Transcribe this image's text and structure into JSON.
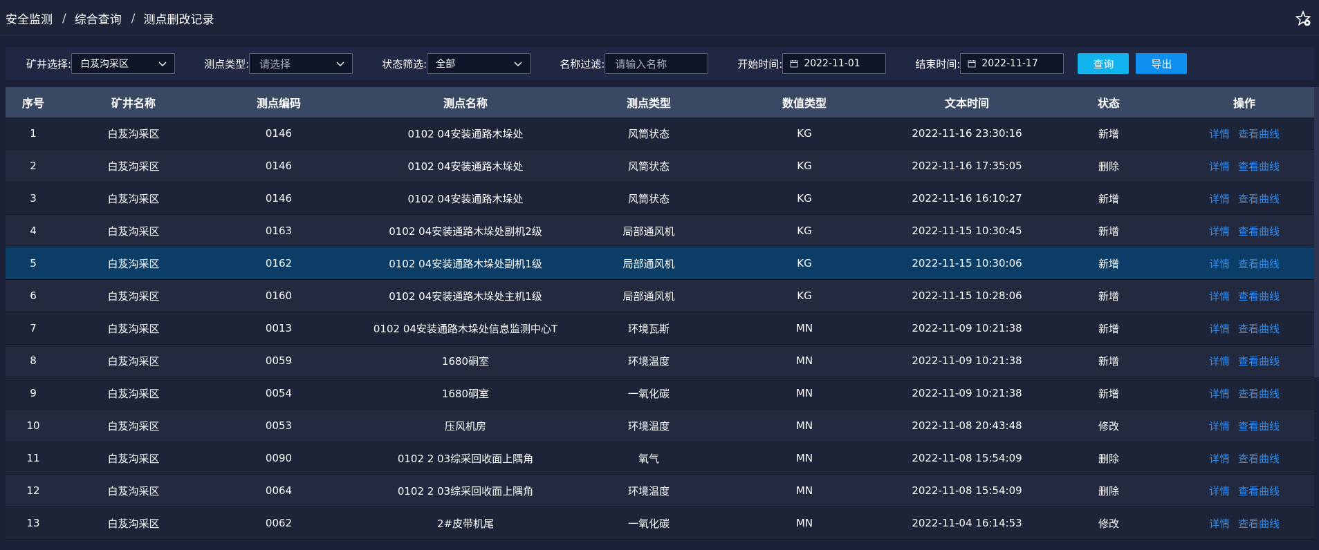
{
  "breadcrumb": [
    "安全监测",
    "综合查询",
    "测点删改记录"
  ],
  "breadcrumb_sep": "/",
  "filters": {
    "mine_label": "矿井选择:",
    "mine_value": "白芨沟采区",
    "type_label": "测点类型:",
    "type_placeholder": "请选择",
    "status_label": "状态筛选:",
    "status_value": "全部",
    "name_label": "名称过滤:",
    "name_placeholder": "请输入名称",
    "start_label": "开始时间:",
    "start_value": "2022-11-01",
    "end_label": "结束时间:",
    "end_value": "2022-11-17",
    "query_label": "查询",
    "export_label": "导出"
  },
  "table": {
    "columns": [
      "序号",
      "矿井名称",
      "测点编码",
      "测点名称",
      "测点类型",
      "数值类型",
      "文本时间",
      "状态",
      "操作"
    ],
    "detail_label": "详情",
    "curve_label": "查看曲线",
    "rows": [
      [
        "1",
        "白芨沟采区",
        "0146",
        "0102 04安装通路木垛处",
        "风筒状态",
        "KG",
        "2022-11-16 23:30:16",
        "新增"
      ],
      [
        "2",
        "白芨沟采区",
        "0146",
        "0102 04安装通路木垛处",
        "风筒状态",
        "KG",
        "2022-11-16 17:35:05",
        "删除"
      ],
      [
        "3",
        "白芨沟采区",
        "0146",
        "0102 04安装通路木垛处",
        "风筒状态",
        "KG",
        "2022-11-16 16:10:27",
        "新增"
      ],
      [
        "4",
        "白芨沟采区",
        "0163",
        "0102 04安装通路木垛处副机2级",
        "局部通风机",
        "KG",
        "2022-11-15 10:30:45",
        "新增"
      ],
      [
        "5",
        "白芨沟采区",
        "0162",
        "0102 04安装通路木垛处副机1级",
        "局部通风机",
        "KG",
        "2022-11-15 10:30:06",
        "新增"
      ],
      [
        "6",
        "白芨沟采区",
        "0160",
        "0102 04安装通路木垛处主机1级",
        "局部通风机",
        "KG",
        "2022-11-15 10:28:06",
        "新增"
      ],
      [
        "7",
        "白芨沟采区",
        "0013",
        "0102 04安装通路木垛处信息监测中心T",
        "环境瓦斯",
        "MN",
        "2022-11-09 10:21:38",
        "新增"
      ],
      [
        "8",
        "白芨沟采区",
        "0059",
        "1680硐室",
        "环境温度",
        "MN",
        "2022-11-09 10:21:38",
        "新增"
      ],
      [
        "9",
        "白芨沟采区",
        "0054",
        "1680硐室",
        "一氧化碳",
        "MN",
        "2022-11-09 10:21:38",
        "新增"
      ],
      [
        "10",
        "白芨沟采区",
        "0053",
        "压风机房",
        "环境温度",
        "MN",
        "2022-11-08 20:43:48",
        "修改"
      ],
      [
        "11",
        "白芨沟采区",
        "0090",
        "0102 2 03综采回收面上隅角",
        "氧气",
        "MN",
        "2022-11-08 15:54:09",
        "删除"
      ],
      [
        "12",
        "白芨沟采区",
        "0064",
        "0102 2 03综采回收面上隅角",
        "环境温度",
        "MN",
        "2022-11-08 15:54:09",
        "删除"
      ],
      [
        "13",
        "白芨沟采区",
        "0062",
        "2#皮带机尾",
        "一氧化碳",
        "MN",
        "2022-11-04 16:14:53",
        "修改"
      ]
    ],
    "selected_row": 4
  },
  "colors": {
    "background": "#1b2136",
    "header_bg": "#3a4963",
    "selected_row": "#0b3d66",
    "link": "#2f8cf0",
    "query_button": "#12b4ee",
    "export_button": "#0d8ff0"
  },
  "icons": [
    "star-settings-icon",
    "chevron-down-icon",
    "calendar-icon"
  ]
}
